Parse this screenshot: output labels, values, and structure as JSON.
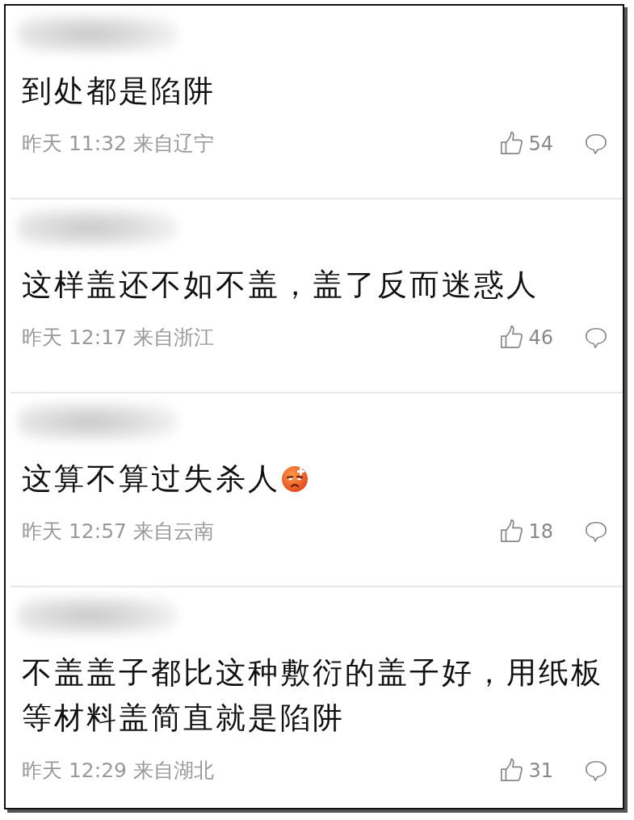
{
  "comments": [
    {
      "text": "到处都是陷阱",
      "emoji": false,
      "meta": "昨天 11:32 来自辽宁",
      "likes": "54"
    },
    {
      "text": "这样盖还不如不盖，盖了反而迷惑人",
      "emoji": false,
      "meta": "昨天 12:17 来自浙江",
      "likes": "46"
    },
    {
      "text": "这算不算过失杀人",
      "emoji": true,
      "meta": "昨天 12:57 来自云南",
      "likes": "18"
    },
    {
      "text": "不盖盖子都比这种敷衍的盖子好，用纸板等材料盖简直就是陷阱",
      "emoji": false,
      "meta": "昨天 12:29 来自湖北",
      "likes": "31"
    }
  ]
}
